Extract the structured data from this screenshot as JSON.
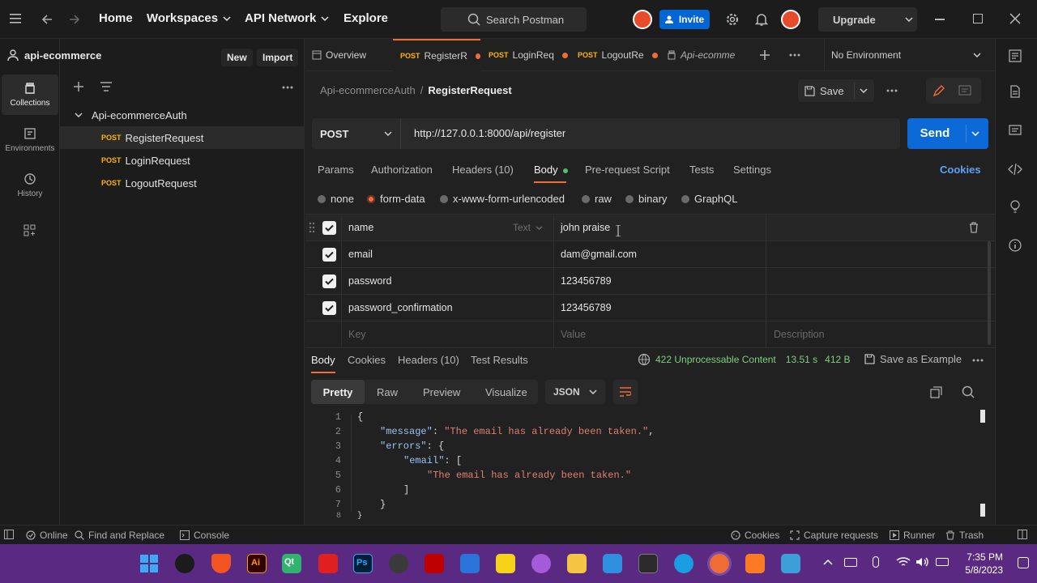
{
  "topbar": {
    "nav": [
      "Home",
      "Workspaces",
      "API Network",
      "Explore"
    ],
    "search_placeholder": "Search Postman",
    "invite_label": "Invite",
    "upgrade_label": "Upgrade"
  },
  "rail": {
    "items": [
      {
        "label": "Collections",
        "icon": "collections-icon"
      },
      {
        "label": "Environments",
        "icon": "environments-icon"
      },
      {
        "label": "History",
        "icon": "history-icon"
      },
      {
        "label": "",
        "icon": "add-apps-icon"
      }
    ]
  },
  "sidebar": {
    "workspace": "api-ecommerce",
    "new_label": "New",
    "import_label": "Import",
    "collection": "Api-ecommerceAuth",
    "requests": [
      {
        "method": "POST",
        "name": "RegisterRequest"
      },
      {
        "method": "POST",
        "name": "LoginRequest"
      },
      {
        "method": "POST",
        "name": "LogoutRequest"
      }
    ]
  },
  "tabs": {
    "overview": "Overview",
    "items": [
      {
        "method": "POST",
        "name": "RegisterR"
      },
      {
        "method": "POST",
        "name": "LoginReq"
      },
      {
        "method": "POST",
        "name": "LogoutRe"
      }
    ],
    "extra": "Api-ecomme",
    "environment": "No Environment"
  },
  "request": {
    "breadcrumb_parent": "Api-ecommerceAuth",
    "breadcrumb_sep": "/",
    "breadcrumb_current": "RegisterRequest",
    "save_label": "Save",
    "method": "POST",
    "url": "http://127.0.0.1:8000/api/register",
    "send_label": "Send",
    "tabs": [
      "Params",
      "Authorization",
      "Headers (10)",
      "Body",
      "Pre-request Script",
      "Tests",
      "Settings"
    ],
    "active_tab": "Body",
    "cookies_label": "Cookies",
    "body_types": [
      "none",
      "form-data",
      "x-www-form-urlencoded",
      "raw",
      "binary",
      "GraphQL"
    ],
    "selected_body_type": "form-data",
    "form_rows": [
      {
        "key": "name",
        "type": "Text",
        "value": "john praise",
        "checked": true
      },
      {
        "key": "email",
        "value": "dam@gmail.com",
        "checked": true
      },
      {
        "key": "password",
        "value": "123456789",
        "checked": true
      },
      {
        "key": "password_confirmation",
        "value": "123456789",
        "checked": true
      }
    ],
    "placeholders": {
      "key": "Key",
      "value": "Value",
      "description": "Description"
    }
  },
  "response": {
    "tabs": [
      "Body",
      "Cookies",
      "Headers (10)",
      "Test Results"
    ],
    "active_tab": "Body",
    "status": "422 Unprocessable Content",
    "time": "13.51 s",
    "size": "412 B",
    "save_example": "Save as Example",
    "view_tabs": [
      "Pretty",
      "Raw",
      "Preview",
      "Visualize"
    ],
    "active_view": "Pretty",
    "format": "JSON",
    "lines": [
      "1",
      "2",
      "3",
      "4",
      "5",
      "6",
      "7",
      "8"
    ],
    "code": {
      "l1": "{",
      "l2_key": "\"message\"",
      "l2_val": "\"The email has already been taken.\"",
      "l3_key": "\"errors\"",
      "l3_rest": ": {",
      "l4_key": "\"email\"",
      "l4_rest": ": [",
      "l5_val": "\"The email has already been taken.\"",
      "l6": "]",
      "l7": "}",
      "l8": "}"
    }
  },
  "status_bar": {
    "online": "Online",
    "find_replace": "Find and Replace",
    "console": "Console",
    "cookies": "Cookies",
    "capture": "Capture requests",
    "runner": "Runner",
    "trash": "Trash"
  },
  "taskbar": {
    "time": "7:35 PM",
    "date": "5/8/2023"
  },
  "colors": {
    "accent_orange": "#f26b3a",
    "send_blue": "#0b6ad8",
    "status_green": "#7ed07e",
    "method_yellow": "#ffb400"
  }
}
